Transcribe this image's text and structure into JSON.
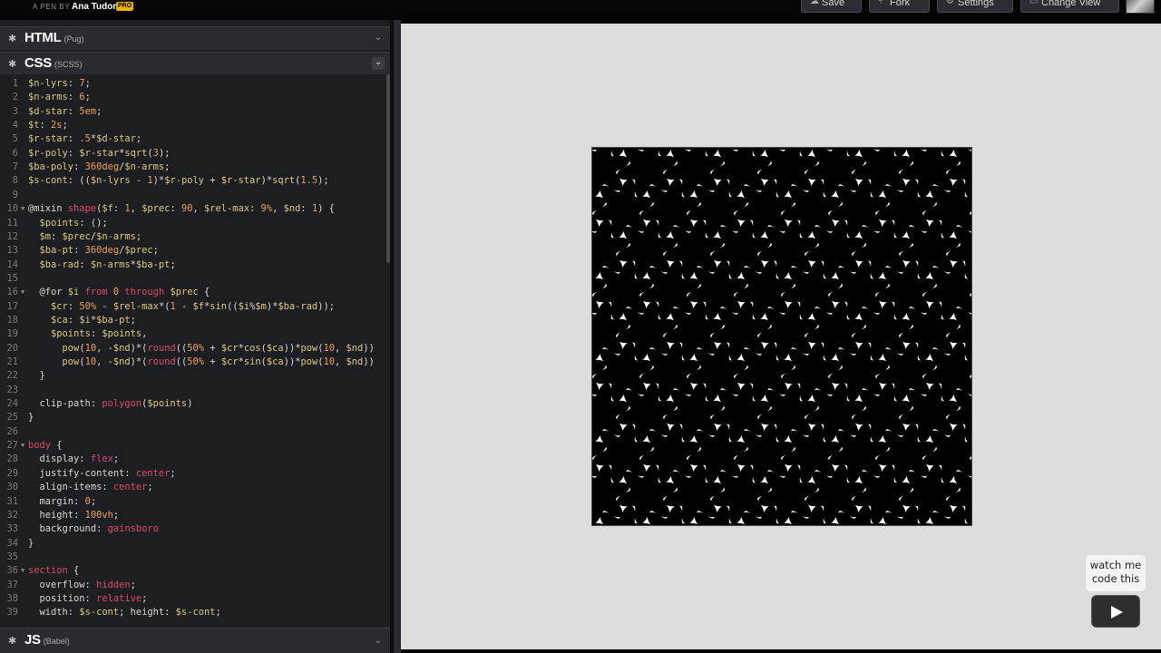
{
  "topbar": {
    "pen_by": "A PEN BY",
    "author": "Ana Tudor",
    "badge": "PRO",
    "buttons": [
      {
        "label": "Save",
        "icon": "cloud-icon"
      },
      {
        "label": "Fork",
        "icon": "fork-icon"
      },
      {
        "label": "Settings",
        "icon": "gear-icon"
      },
      {
        "label": "Change View",
        "icon": "layout-icon"
      }
    ]
  },
  "panels": {
    "html": {
      "lang": "HTML",
      "sub": "(Pug)"
    },
    "css": {
      "lang": "CSS",
      "sub": "(SCSS)"
    },
    "js": {
      "lang": "JS",
      "sub": "(Babel)"
    }
  },
  "code_lines": [
    {
      "n": "1",
      "f": false,
      "t": [
        [
          "v",
          "$n-lyrs"
        ],
        [
          "p",
          ": "
        ],
        [
          "n",
          "7"
        ],
        [
          "p",
          ";"
        ]
      ]
    },
    {
      "n": "2",
      "f": false,
      "t": [
        [
          "v",
          "$n-arms"
        ],
        [
          "p",
          ": "
        ],
        [
          "n",
          "6"
        ],
        [
          "p",
          ";"
        ]
      ]
    },
    {
      "n": "3",
      "f": false,
      "t": [
        [
          "v",
          "$d-star"
        ],
        [
          "p",
          ": "
        ],
        [
          "n",
          "5em"
        ],
        [
          "p",
          ";"
        ]
      ]
    },
    {
      "n": "4",
      "f": false,
      "t": [
        [
          "v",
          "$t"
        ],
        [
          "p",
          ": "
        ],
        [
          "n",
          "2s"
        ],
        [
          "p",
          ";"
        ]
      ]
    },
    {
      "n": "5",
      "f": false,
      "t": [
        [
          "v",
          "$r-star"
        ],
        [
          "p",
          ": "
        ],
        [
          "n",
          ".5"
        ],
        [
          "p",
          "*"
        ],
        [
          "v",
          "$d-star"
        ],
        [
          "p",
          ";"
        ]
      ]
    },
    {
      "n": "6",
      "f": false,
      "t": [
        [
          "v",
          "$r-poly"
        ],
        [
          "p",
          ": "
        ],
        [
          "v",
          "$r-star"
        ],
        [
          "p",
          "*"
        ],
        [
          "v",
          "sqrt"
        ],
        [
          "p",
          "("
        ],
        [
          "n",
          "3"
        ],
        [
          "p",
          ");"
        ]
      ]
    },
    {
      "n": "7",
      "f": false,
      "t": [
        [
          "v",
          "$ba-poly"
        ],
        [
          "p",
          ": "
        ],
        [
          "n",
          "360deg"
        ],
        [
          "p",
          "/"
        ],
        [
          "v",
          "$n-arms"
        ],
        [
          "p",
          ";"
        ]
      ]
    },
    {
      "n": "8",
      "f": false,
      "t": [
        [
          "v",
          "$s-cont"
        ],
        [
          "p",
          ": (("
        ],
        [
          "v",
          "$n-lyrs"
        ],
        [
          "p",
          " - "
        ],
        [
          "n",
          "1"
        ],
        [
          "p",
          ")*"
        ],
        [
          "v",
          "$r-poly"
        ],
        [
          "p",
          " + "
        ],
        [
          "v",
          "$r-star"
        ],
        [
          "p",
          ")*"
        ],
        [
          "v",
          "sqrt"
        ],
        [
          "p",
          "("
        ],
        [
          "n",
          "1.5"
        ],
        [
          "p",
          ");"
        ]
      ]
    },
    {
      "n": "9",
      "f": false,
      "t": []
    },
    {
      "n": "10",
      "f": true,
      "t": [
        [
          "p",
          "@mixin "
        ],
        [
          "k",
          "shape"
        ],
        [
          "p",
          "("
        ],
        [
          "v",
          "$f"
        ],
        [
          "p",
          ": "
        ],
        [
          "n",
          "1"
        ],
        [
          "p",
          ", "
        ],
        [
          "v",
          "$prec"
        ],
        [
          "p",
          ": "
        ],
        [
          "n",
          "90"
        ],
        [
          "p",
          ", "
        ],
        [
          "v",
          "$rel-max"
        ],
        [
          "p",
          ": "
        ],
        [
          "n",
          "9%"
        ],
        [
          "p",
          ", "
        ],
        [
          "v",
          "$nd"
        ],
        [
          "p",
          ": "
        ],
        [
          "n",
          "1"
        ],
        [
          "p",
          ") {"
        ]
      ]
    },
    {
      "n": "11",
      "f": false,
      "t": [
        [
          "p",
          "  "
        ],
        [
          "v",
          "$points"
        ],
        [
          "p",
          ": ();"
        ]
      ]
    },
    {
      "n": "12",
      "f": false,
      "t": [
        [
          "p",
          "  "
        ],
        [
          "v",
          "$m"
        ],
        [
          "p",
          ": "
        ],
        [
          "v",
          "$prec"
        ],
        [
          "p",
          "/"
        ],
        [
          "v",
          "$n-arms"
        ],
        [
          "p",
          ";"
        ]
      ]
    },
    {
      "n": "13",
      "f": false,
      "t": [
        [
          "p",
          "  "
        ],
        [
          "v",
          "$ba-pt"
        ],
        [
          "p",
          ": "
        ],
        [
          "n",
          "360deg"
        ],
        [
          "p",
          "/"
        ],
        [
          "v",
          "$prec"
        ],
        [
          "p",
          ";"
        ]
      ]
    },
    {
      "n": "14",
      "f": false,
      "t": [
        [
          "p",
          "  "
        ],
        [
          "v",
          "$ba-rad"
        ],
        [
          "p",
          ": "
        ],
        [
          "v",
          "$n-arms"
        ],
        [
          "p",
          "*"
        ],
        [
          "v",
          "$ba-pt"
        ],
        [
          "p",
          ";"
        ]
      ]
    },
    {
      "n": "15",
      "f": false,
      "t": []
    },
    {
      "n": "16",
      "f": true,
      "t": [
        [
          "p",
          "  @for "
        ],
        [
          "v",
          "$i"
        ],
        [
          "p",
          " "
        ],
        [
          "k",
          "from"
        ],
        [
          "p",
          " "
        ],
        [
          "n",
          "0"
        ],
        [
          "p",
          " "
        ],
        [
          "k",
          "through"
        ],
        [
          "p",
          " "
        ],
        [
          "v",
          "$prec"
        ],
        [
          "p",
          " {"
        ]
      ]
    },
    {
      "n": "17",
      "f": false,
      "t": [
        [
          "p",
          "    "
        ],
        [
          "v",
          "$cr"
        ],
        [
          "p",
          ": "
        ],
        [
          "n",
          "50%"
        ],
        [
          "p",
          " - "
        ],
        [
          "v",
          "$rel-max"
        ],
        [
          "p",
          "*("
        ],
        [
          "n",
          "1"
        ],
        [
          "p",
          " - "
        ],
        [
          "v",
          "$f"
        ],
        [
          "p",
          "*"
        ],
        [
          "v",
          "sin"
        ],
        [
          "p",
          "(("
        ],
        [
          "v",
          "$i"
        ],
        [
          "p",
          "%"
        ],
        [
          "v",
          "$m"
        ],
        [
          "p",
          ")*"
        ],
        [
          "v",
          "$ba-rad"
        ],
        [
          "p",
          "));"
        ]
      ]
    },
    {
      "n": "18",
      "f": false,
      "t": [
        [
          "p",
          "    "
        ],
        [
          "v",
          "$ca"
        ],
        [
          "p",
          ": "
        ],
        [
          "v",
          "$i"
        ],
        [
          "p",
          "*"
        ],
        [
          "v",
          "$ba-pt"
        ],
        [
          "p",
          ";"
        ]
      ]
    },
    {
      "n": "19",
      "f": false,
      "t": [
        [
          "p",
          "    "
        ],
        [
          "v",
          "$points"
        ],
        [
          "p",
          ": "
        ],
        [
          "v",
          "$points"
        ],
        [
          "p",
          ","
        ]
      ]
    },
    {
      "n": "20",
      "f": false,
      "t": [
        [
          "p",
          "      "
        ],
        [
          "v",
          "pow"
        ],
        [
          "p",
          "("
        ],
        [
          "n",
          "10"
        ],
        [
          "p",
          ", -"
        ],
        [
          "v",
          "$nd"
        ],
        [
          "p",
          ")*("
        ],
        [
          "k",
          "round"
        ],
        [
          "p",
          "(("
        ],
        [
          "n",
          "50%"
        ],
        [
          "p",
          " + "
        ],
        [
          "v",
          "$cr"
        ],
        [
          "p",
          "*"
        ],
        [
          "v",
          "cos"
        ],
        [
          "p",
          "("
        ],
        [
          "v",
          "$ca"
        ],
        [
          "p",
          "))*"
        ],
        [
          "v",
          "pow"
        ],
        [
          "p",
          "("
        ],
        [
          "n",
          "10"
        ],
        [
          "p",
          ", "
        ],
        [
          "v",
          "$nd"
        ],
        [
          "p",
          "))"
        ]
      ]
    },
    {
      "n": "21",
      "f": false,
      "t": [
        [
          "p",
          "      "
        ],
        [
          "v",
          "pow"
        ],
        [
          "p",
          "("
        ],
        [
          "n",
          "10"
        ],
        [
          "p",
          ", -"
        ],
        [
          "v",
          "$nd"
        ],
        [
          "p",
          ")*("
        ],
        [
          "k",
          "round"
        ],
        [
          "p",
          "(("
        ],
        [
          "n",
          "50%"
        ],
        [
          "p",
          " + "
        ],
        [
          "v",
          "$cr"
        ],
        [
          "p",
          "*"
        ],
        [
          "v",
          "sin"
        ],
        [
          "p",
          "("
        ],
        [
          "v",
          "$ca"
        ],
        [
          "p",
          "))*"
        ],
        [
          "v",
          "pow"
        ],
        [
          "p",
          "("
        ],
        [
          "n",
          "10"
        ],
        [
          "p",
          ", "
        ],
        [
          "v",
          "$nd"
        ],
        [
          "p",
          "))"
        ]
      ]
    },
    {
      "n": "22",
      "f": false,
      "t": [
        [
          "p",
          "  }"
        ]
      ]
    },
    {
      "n": "23",
      "f": false,
      "t": []
    },
    {
      "n": "24",
      "f": false,
      "t": [
        [
          "p",
          "  clip-path: "
        ],
        [
          "k",
          "polygon"
        ],
        [
          "p",
          "("
        ],
        [
          "v",
          "$points"
        ],
        [
          "p",
          ")"
        ]
      ]
    },
    {
      "n": "25",
      "f": false,
      "t": [
        [
          "p",
          "}"
        ]
      ]
    },
    {
      "n": "26",
      "f": false,
      "t": []
    },
    {
      "n": "27",
      "f": true,
      "t": [
        [
          "k",
          "body"
        ],
        [
          "p",
          " {"
        ]
      ]
    },
    {
      "n": "28",
      "f": false,
      "t": [
        [
          "p",
          "  display: "
        ],
        [
          "k",
          "flex"
        ],
        [
          "p",
          ";"
        ]
      ]
    },
    {
      "n": "29",
      "f": false,
      "t": [
        [
          "p",
          "  justify-content: "
        ],
        [
          "k",
          "center"
        ],
        [
          "p",
          ";"
        ]
      ]
    },
    {
      "n": "30",
      "f": false,
      "t": [
        [
          "p",
          "  align-items: "
        ],
        [
          "k",
          "center"
        ],
        [
          "p",
          ";"
        ]
      ]
    },
    {
      "n": "31",
      "f": false,
      "t": [
        [
          "p",
          "  margin: "
        ],
        [
          "n",
          "0"
        ],
        [
          "p",
          ";"
        ]
      ]
    },
    {
      "n": "32",
      "f": false,
      "t": [
        [
          "p",
          "  height: "
        ],
        [
          "n",
          "100vh"
        ],
        [
          "p",
          ";"
        ]
      ]
    },
    {
      "n": "33",
      "f": false,
      "t": [
        [
          "p",
          "  background: "
        ],
        [
          "k",
          "gainsboro"
        ]
      ]
    },
    {
      "n": "34",
      "f": false,
      "t": [
        [
          "p",
          "}"
        ]
      ]
    },
    {
      "n": "35",
      "f": false,
      "t": []
    },
    {
      "n": "36",
      "f": true,
      "t": [
        [
          "k",
          "section"
        ],
        [
          "p",
          " {"
        ]
      ]
    },
    {
      "n": "37",
      "f": false,
      "t": [
        [
          "p",
          "  overflow: "
        ],
        [
          "k",
          "hidden"
        ],
        [
          "p",
          ";"
        ]
      ]
    },
    {
      "n": "38",
      "f": false,
      "t": [
        [
          "p",
          "  position: "
        ],
        [
          "k",
          "relative"
        ],
        [
          "p",
          ";"
        ]
      ]
    },
    {
      "n": "39",
      "f": false,
      "t": [
        [
          "p",
          "  width: "
        ],
        [
          "v",
          "$s-cont"
        ],
        [
          "p",
          "; height: "
        ],
        [
          "v",
          "$s-cont"
        ],
        [
          "p",
          ";"
        ]
      ]
    }
  ],
  "preview": {
    "background": "#dcdcdc",
    "star_color": "#000000",
    "gap_color": "#ffffff"
  },
  "watch": {
    "line1": "watch me",
    "line2": "code this",
    "play_icon": "play-icon"
  }
}
